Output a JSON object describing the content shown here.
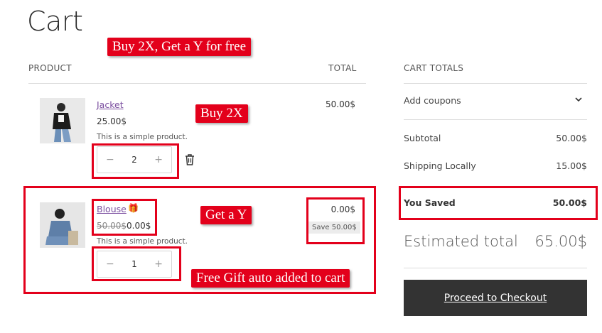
{
  "page": {
    "title": "Cart"
  },
  "table": {
    "product_header": "PRODUCT",
    "total_header": "TOTAL"
  },
  "items": [
    {
      "name": "Jacket",
      "price": "25.00$",
      "description": "This is a simple product.",
      "quantity": "2",
      "line_total": "50.00$"
    },
    {
      "name": "Blouse",
      "gift_icon": "🎁",
      "original_price": "50.00$",
      "price": "0.00$",
      "description": "This is a simple product.",
      "quantity": "1",
      "line_total": "0.00$",
      "save_text": "Save 50.00$"
    }
  ],
  "quantity_controls": {
    "minus": "−",
    "plus": "+"
  },
  "totals": {
    "header": "CART TOTALS",
    "coupons_label": "Add coupons",
    "subtotal_label": "Subtotal",
    "subtotal_value": "50.00$",
    "shipping_label": "Shipping Locally",
    "shipping_value": "15.00$",
    "saved_label": "You Saved",
    "saved_value": "50.00$",
    "estimated_label": "Estimated total",
    "estimated_value": "65.00$",
    "checkout_label": "Proceed to Checkout"
  },
  "annotations": {
    "promo": "Buy 2X, Get a Y for free",
    "buy": "Buy 2X",
    "get": "Get a Y",
    "auto_added": "Free Gift auto added to cart"
  },
  "colors": {
    "annotation_red": "#e3001b",
    "link_purple": "#7b4fa0",
    "checkout_bg": "#333333"
  }
}
